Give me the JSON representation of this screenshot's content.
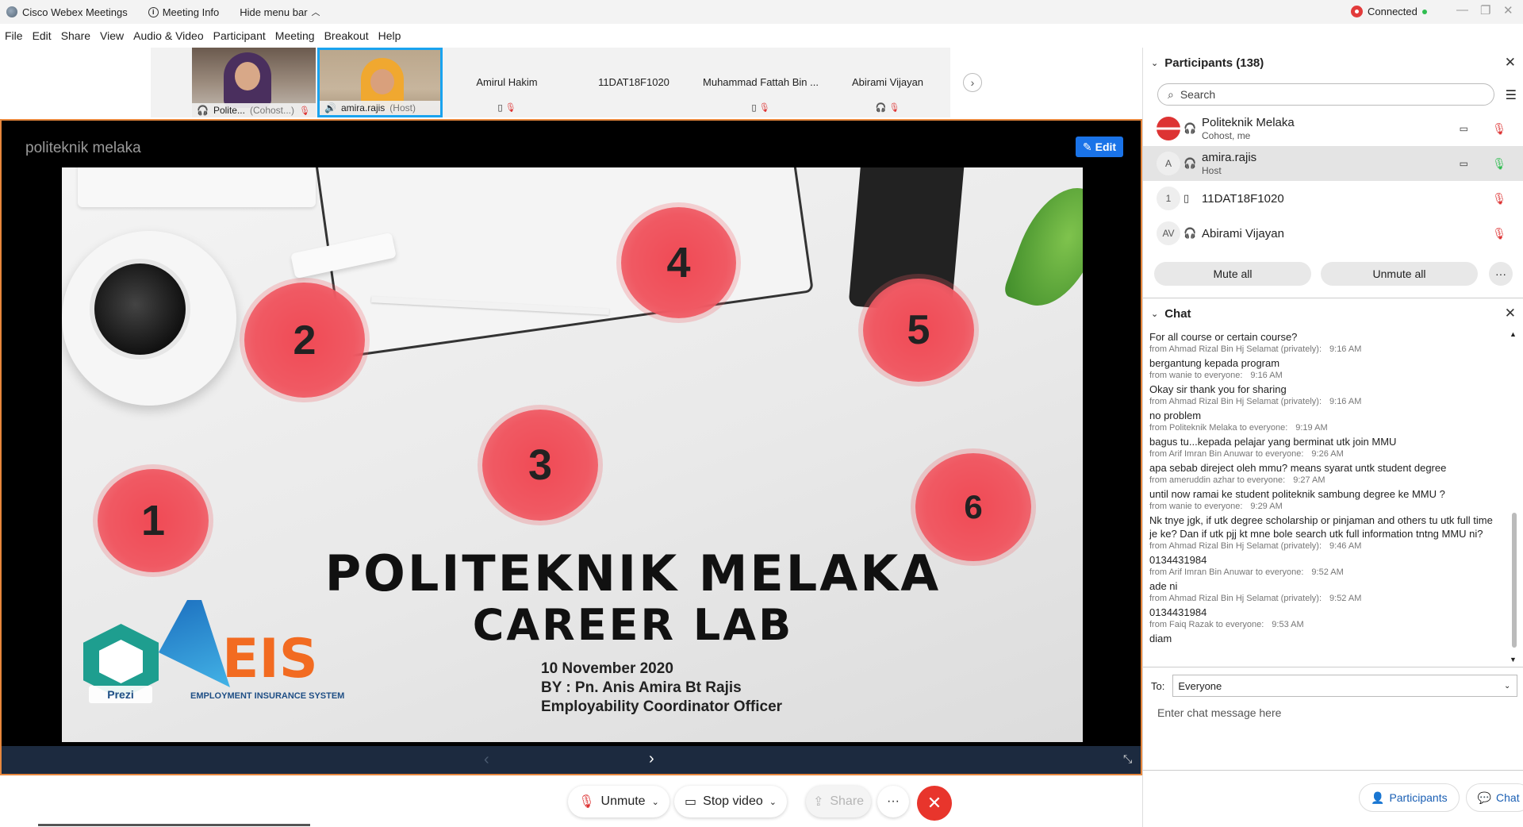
{
  "titlebar": {
    "app_title": "Cisco Webex Meetings",
    "meeting_info": "Meeting Info",
    "hide_menu": "Hide menu bar",
    "status": "Connected"
  },
  "menu": [
    "File",
    "Edit",
    "Share",
    "View",
    "Audio & Video",
    "Participant",
    "Meeting",
    "Breakout",
    "Help"
  ],
  "thumbnails": {
    "videos": [
      {
        "name": "Polite...",
        "role": "(Cohost...)"
      },
      {
        "name": "amira.rajis",
        "role": "(Host)"
      }
    ],
    "names": [
      "Amirul Hakim",
      "11DAT18F1020",
      "Muhammad Fattah Bin ...",
      "Abirami Vijayan"
    ]
  },
  "share": {
    "brand": "politeknik melaka",
    "edit_label": "Edit",
    "slide": {
      "numbers": [
        "1",
        "2",
        "3",
        "4",
        "5",
        "6"
      ],
      "title1": "POLITEKNIK MELAKA",
      "title2": "CAREER LAB",
      "date": "10 November 2020",
      "by": "BY : Pn. Anis Amira Bt Rajis",
      "role": "Employability Coordinator Officer",
      "logo_text": "EIS",
      "logo_sub": "EMPLOYMENT INSURANCE SYSTEM",
      "prezi": "Prezi"
    }
  },
  "controls": {
    "unmute": "Unmute",
    "stop_video": "Stop video",
    "share": "Share",
    "more": "···"
  },
  "participants": {
    "title": "Participants (138)",
    "search_placeholder": "Search",
    "list": [
      {
        "avatar": "",
        "name": "Politeknik Melaka",
        "sub": "Cohost, me"
      },
      {
        "avatar": "A",
        "name": "amira.rajis",
        "sub": "Host"
      },
      {
        "avatar": "1",
        "name": "11DAT18F1020",
        "sub": ""
      },
      {
        "avatar": "AV",
        "name": "Abirami Vijayan",
        "sub": ""
      }
    ],
    "mute_all": "Mute all",
    "unmute_all": "Unmute all",
    "more": "···"
  },
  "chat": {
    "title": "Chat",
    "messages": [
      {
        "text": "For all course or certain course?",
        "from": "from Ahmad Rizal Bin Hj Selamat (privately):",
        "time": "9:16 AM"
      },
      {
        "text": "bergantung kepada program",
        "from": "from wanie to everyone:",
        "time": "9:16 AM"
      },
      {
        "text": "Okay sir thank you for sharing",
        "from": "from Ahmad Rizal Bin Hj Selamat (privately):",
        "time": "9:16 AM"
      },
      {
        "text": "no problem",
        "from": "from Politeknik Melaka to everyone:",
        "time": "9:19 AM"
      },
      {
        "text": "bagus tu...kepada pelajar yang berminat utk join MMU",
        "from": "from Arif Imran Bin Anuwar to everyone:",
        "time": "9:26 AM"
      },
      {
        "text": "apa sebab direject oleh mmu? means syarat untk student degree",
        "from": "from ameruddin azhar to everyone:",
        "time": "9:27 AM"
      },
      {
        "text": "until now ramai ke student politeknik sambung degree ke MMU ?",
        "from": "from wanie to everyone:",
        "time": "9:29 AM"
      },
      {
        "text": "Nk tnye jgk, if utk degree scholarship or pinjaman and others tu utk full time je ke? Dan if utk pjj kt mne bole search utk full information tntng MMU ni?",
        "from": "from Ahmad Rizal Bin Hj Selamat (privately):",
        "time": "9:46 AM"
      },
      {
        "text": "0134431984",
        "from": "from Arif Imran Bin Anuwar to everyone:",
        "time": "9:52 AM"
      },
      {
        "text": "ade ni",
        "from": "from Ahmad Rizal Bin Hj Selamat (privately):",
        "time": "9:52 AM"
      },
      {
        "text": "0134431984",
        "from": "from Faiq Razak to everyone:",
        "time": "9:53 AM"
      },
      {
        "text": "diam",
        "from": "",
        "time": ""
      }
    ],
    "to_label": "To:",
    "to_value": "Everyone",
    "input_placeholder": "Enter chat message here"
  },
  "panel_tabs": {
    "participants": "Participants",
    "chat": "Chat"
  },
  "colors": {
    "accent": "#1a73e8",
    "share_border": "#e7873d",
    "end": "#e8352c",
    "muted": "#dd3333",
    "unmuted": "#2fbd50"
  }
}
